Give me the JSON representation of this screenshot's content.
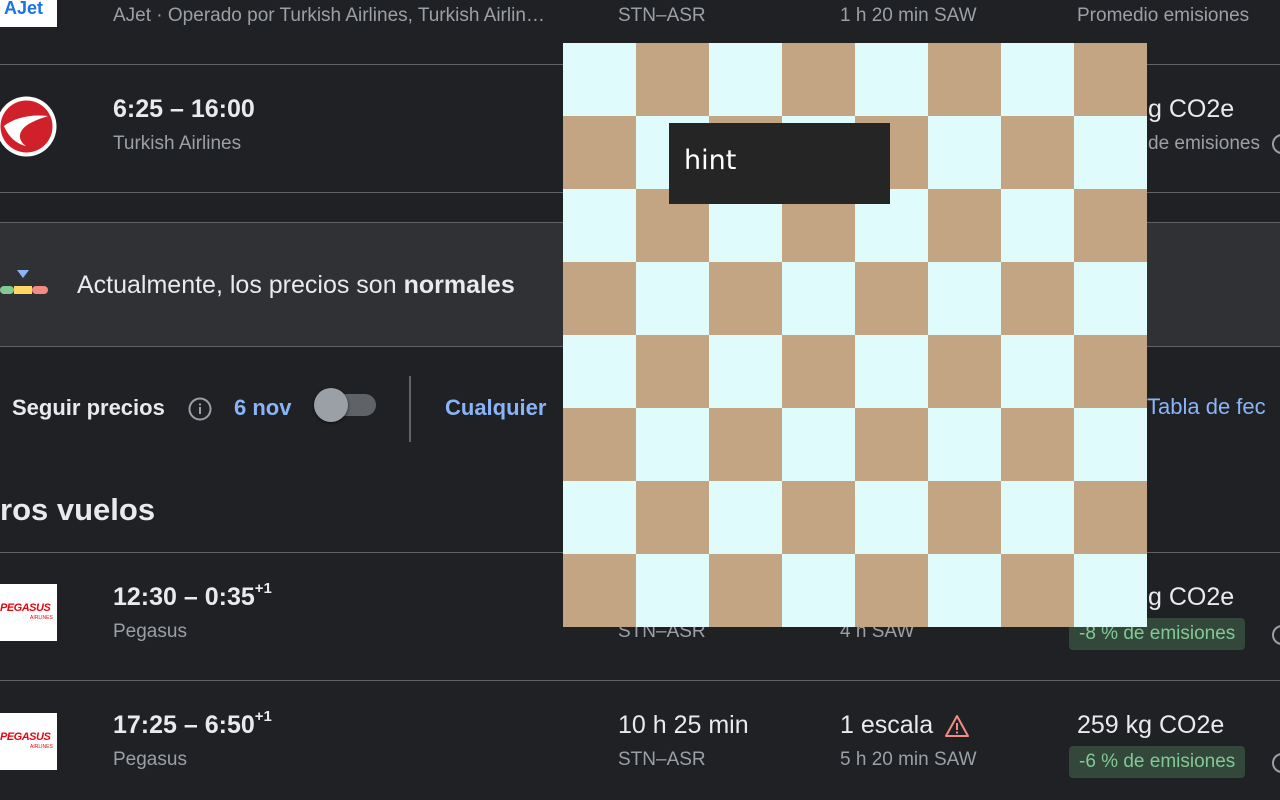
{
  "rows_top": [
    {
      "logo_text": "AJet",
      "airline": "AJet · Operado por Turkish Airlines, Turkish Airlin…",
      "route": "STN–ASR",
      "stop_info": "1 h 20 min SAW",
      "emissions_label": "Promedio emisiones"
    },
    {
      "times": "6:25 – 16:00",
      "airline": "Turkish Airlines",
      "co2": "g CO2e",
      "emissions_label": "de emisiones"
    }
  ],
  "banner": {
    "text_prefix": "Actualmente, los precios son ",
    "text_bold": "normales"
  },
  "tracking": {
    "label": "Seguir precios",
    "date": "6 nov",
    "any_dates": "Cualquier",
    "date_grid": "Tabla de fec"
  },
  "section_title": "ros vuelos",
  "rows_bottom": [
    {
      "logo_text": "PEGASUS",
      "logo_sub": "AIRLINES",
      "times": "12:30 – 0:35",
      "plus": "+1",
      "airline": "Pegasus",
      "route": "STN–ASR",
      "stop_info": "4 h SAW",
      "co2": "g CO2e",
      "emissions_badge": "-8 % de emisiones"
    },
    {
      "logo_text": "PEGASUS",
      "logo_sub": "AIRLINES",
      "times": "17:25 – 6:50",
      "plus": "+1",
      "airline": "Pegasus",
      "duration": "10 h 25 min",
      "route": "STN–ASR",
      "stops": "1 escala",
      "stop_info": "5 h 20 min SAW",
      "co2": "259 kg CO2e",
      "emissions_badge": "-6 % de emisiones"
    }
  ],
  "overlay": {
    "hint_label": "hint",
    "board_colors": {
      "light": "#e0fbfb",
      "dark": "#c4a583"
    }
  },
  "icons": {
    "info": "info-icon",
    "warning": "warning-icon",
    "price-indicator": "price-level-icon"
  }
}
